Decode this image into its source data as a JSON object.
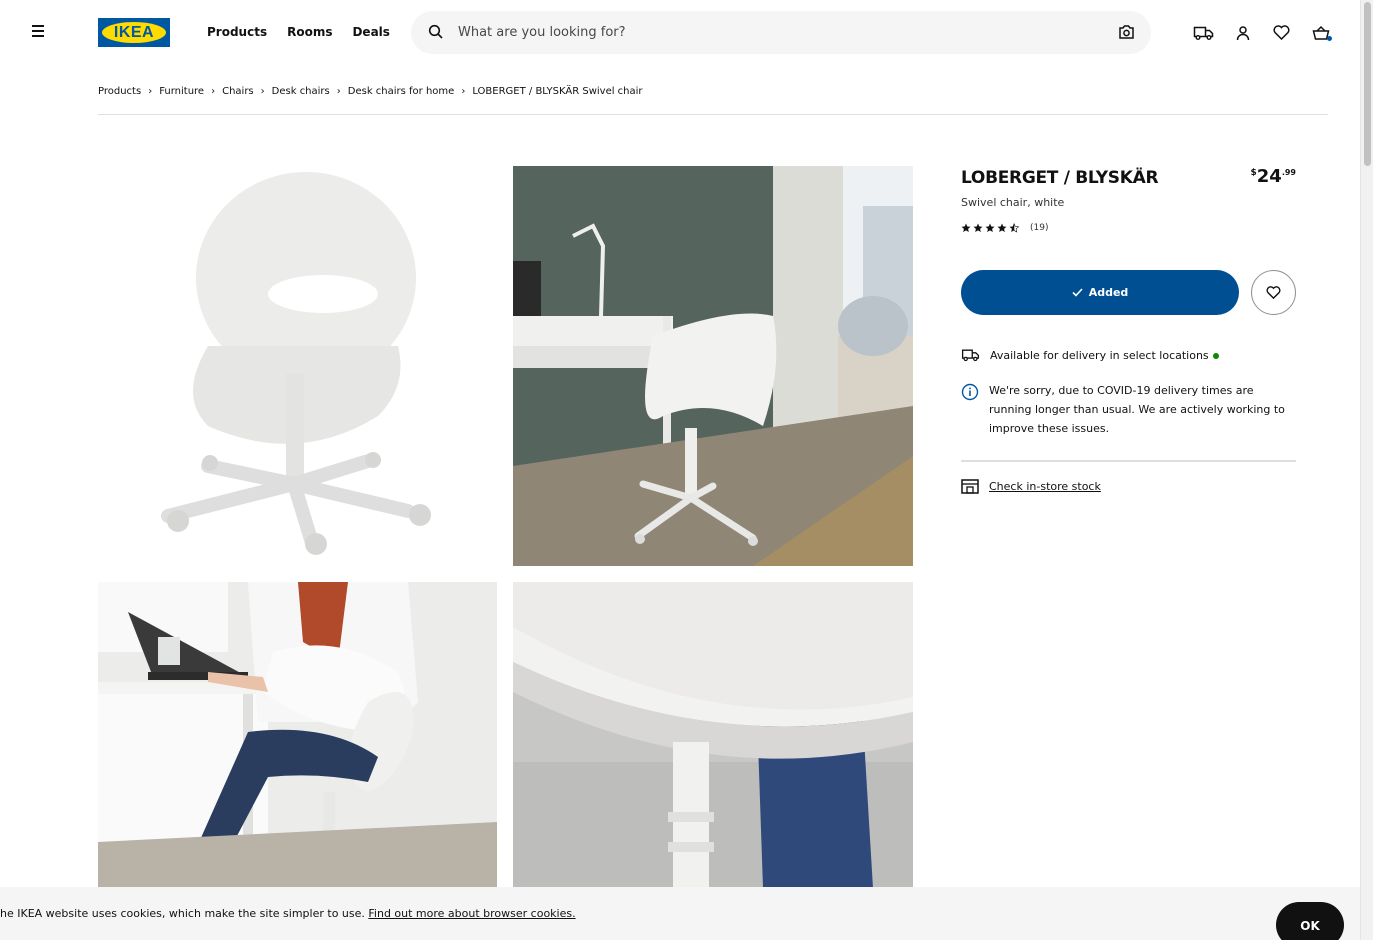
{
  "header": {
    "logo_text": "IKEA",
    "nav": [
      "Products",
      "Rooms",
      "Deals"
    ],
    "search_placeholder": "What are you looking for?"
  },
  "breadcrumb": [
    "Products",
    "Furniture",
    "Chairs",
    "Desk chairs",
    "Desk chairs for home",
    "LOBERGET / BLYSKÄR Swivel chair"
  ],
  "product": {
    "name": "LOBERGET / BLYSKÄR",
    "description": "Swivel chair, white",
    "price_currency": "$",
    "price_integer": "24",
    "price_decimal": ".99",
    "rating": 4.5,
    "review_count": "(19)",
    "added_label": "Added",
    "delivery_text": "Available for delivery in select locations",
    "notice_text": "We're sorry, due to COVID-19 delivery times are running longer than usual. We are actively working to improve these issues.",
    "stock_link": "Check in-store stock"
  },
  "cookie": {
    "text": "he IKEA website uses cookies, which make the site simpler to use.",
    "link": "Find out more about browser cookies.",
    "ok_label": "OK"
  },
  "colors": {
    "brand_blue": "#0058a3",
    "brand_yellow": "#ffdb00",
    "button_blue": "#004f93",
    "availability_green": "#0a8a00"
  }
}
